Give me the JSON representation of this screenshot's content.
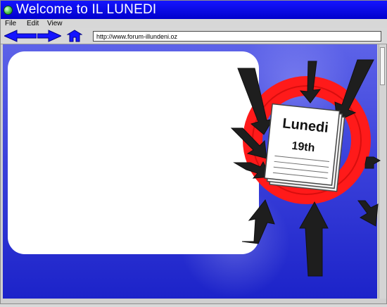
{
  "window": {
    "title": "Welcome to IL LUNEDI"
  },
  "menu": {
    "items": [
      "File",
      "Edit",
      "View"
    ]
  },
  "toolbar": {
    "back_icon": "arrow-left-icon",
    "forward_icon": "arrow-right-icon",
    "home_icon": "home-icon"
  },
  "address_bar": {
    "url": "http://www.forum-illundeni.oz"
  },
  "illustration": {
    "title": "Lunedi",
    "subtitle": "19th"
  },
  "colors": {
    "titlebar": "#0000cc",
    "content_blue": "#3c42db",
    "ring_red": "#ff1a1a"
  }
}
